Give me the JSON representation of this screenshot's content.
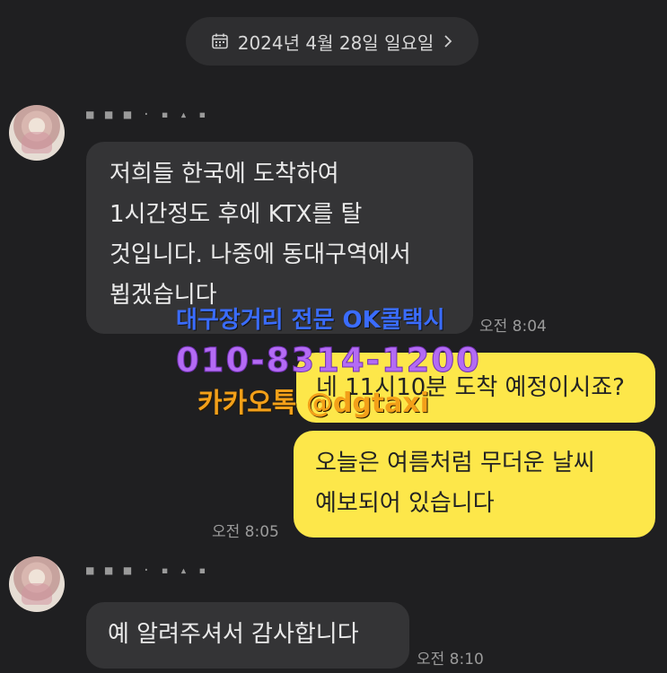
{
  "date_header": {
    "label": "2024년 4월 28일 일요일"
  },
  "messages": [
    {
      "sender": "■ ■ ■ ·  ▪ ▴ ▪",
      "text": "저희들 한국에 도착하여\n1시간정도 후에 KTX를 탈\n것입니다. 나중에 동대구역에서\n뵙겠습니다",
      "time": "오전 8:04"
    },
    {
      "text": "네 11시10분 도착 예정이시죠?"
    },
    {
      "text": "오늘은 여름처럼 무더운 날씨\n예보되어 있습니다",
      "time": "오전 8:05"
    },
    {
      "sender": "■ ■ ■ ·  ▪ ▴ ▪",
      "text": "예 알려주셔서 감사합니다",
      "time": "오전 8:10"
    }
  ],
  "watermark": {
    "line1": "대구장거리 전문 OK콜택시",
    "line2": "010-8314-1200",
    "line3": "카카오톡 @dgtaxi"
  },
  "colors": {
    "background": "#1f1f21",
    "incoming_bubble": "#343436",
    "outgoing_bubble": "#fde74a"
  }
}
